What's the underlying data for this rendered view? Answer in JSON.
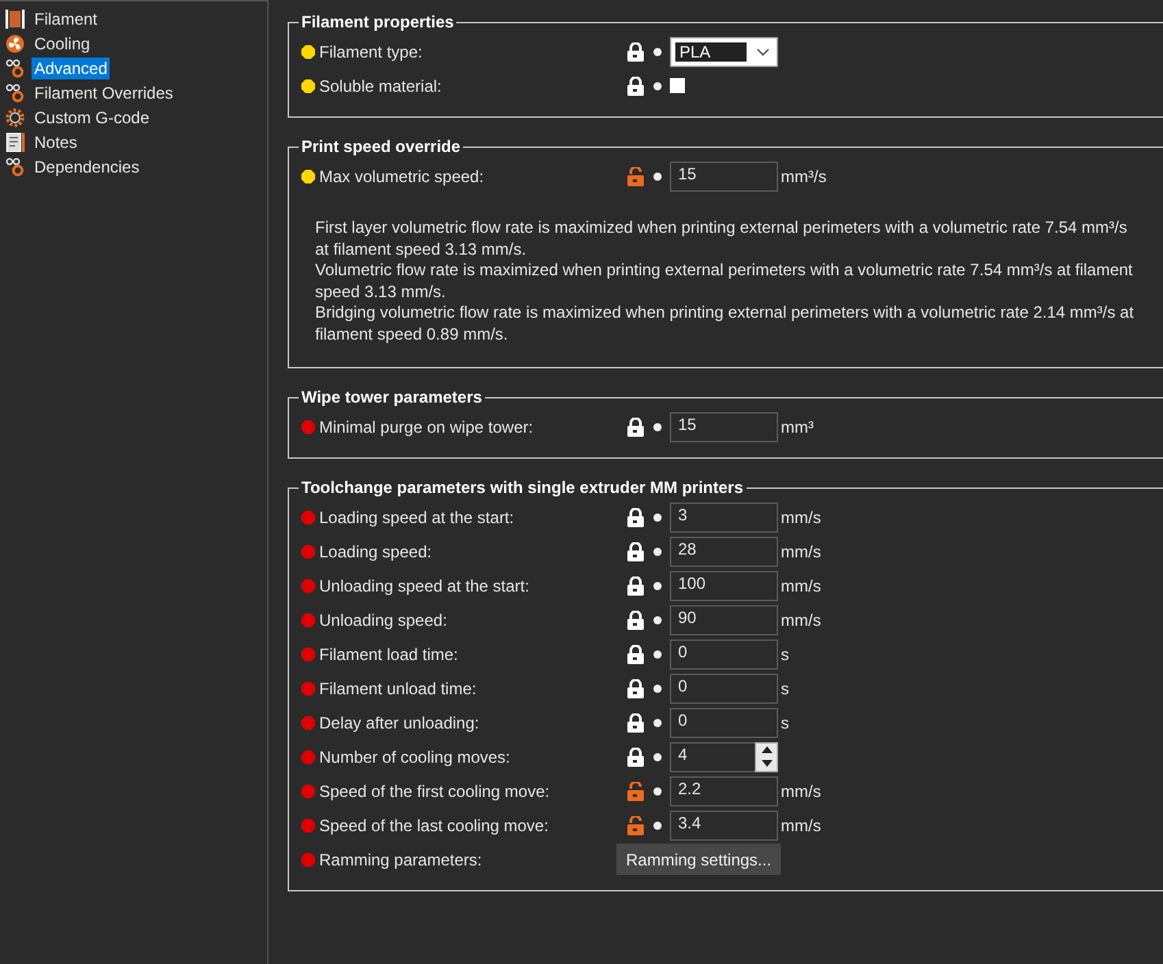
{
  "sidebar": {
    "items": [
      {
        "label": "Filament",
        "selected": false
      },
      {
        "label": "Cooling",
        "selected": false
      },
      {
        "label": "Advanced",
        "selected": true
      },
      {
        "label": "Filament Overrides",
        "selected": false
      },
      {
        "label": "Custom G-code",
        "selected": false
      },
      {
        "label": "Notes",
        "selected": false
      },
      {
        "label": "Dependencies",
        "selected": false
      }
    ]
  },
  "groups": [
    {
      "title": "Filament properties",
      "rows": [
        {
          "label": "Filament type:",
          "color": "#ffd700",
          "locked": true,
          "kind": "combo",
          "value": "PLA"
        },
        {
          "label": "Soluble material:",
          "color": "#ffd700",
          "locked": true,
          "kind": "checkbox",
          "checked": false
        }
      ]
    },
    {
      "title": "Print speed override",
      "rows": [
        {
          "label": "Max volumetric speed:",
          "color": "#ffd700",
          "locked": false,
          "kind": "text",
          "value": "15",
          "unit": "mm³/s"
        }
      ],
      "notes": [
        "First layer volumetric flow rate is maximized when printing external perimeters with a volumetric rate 7.54 mm³/s at filament speed 3.13 mm/s.",
        "Volumetric flow rate is maximized when printing external perimeters with a volumetric rate 7.54 mm³/s at filament speed 3.13 mm/s.",
        "Bridging volumetric flow rate is maximized when printing external perimeters with a volumetric rate 2.14 mm³/s at filament speed 0.89 mm/s."
      ]
    },
    {
      "title": "Wipe tower parameters",
      "rows": [
        {
          "label": "Minimal purge on wipe tower:",
          "color": "#e00000",
          "locked": true,
          "kind": "text",
          "value": "15",
          "unit": "mm³"
        }
      ]
    },
    {
      "title": "Toolchange parameters with single extruder MM printers",
      "rows": [
        {
          "label": "Loading speed at the start:",
          "color": "#e00000",
          "locked": true,
          "kind": "text",
          "value": "3",
          "unit": "mm/s"
        },
        {
          "label": "Loading speed:",
          "color": "#e00000",
          "locked": true,
          "kind": "text",
          "value": "28",
          "unit": "mm/s"
        },
        {
          "label": "Unloading speed at the start:",
          "color": "#e00000",
          "locked": true,
          "kind": "text",
          "value": "100",
          "unit": "mm/s"
        },
        {
          "label": "Unloading speed:",
          "color": "#e00000",
          "locked": true,
          "kind": "text",
          "value": "90",
          "unit": "mm/s"
        },
        {
          "label": "Filament load time:",
          "color": "#e00000",
          "locked": true,
          "kind": "text",
          "value": "0",
          "unit": "s"
        },
        {
          "label": "Filament unload time:",
          "color": "#e00000",
          "locked": true,
          "kind": "text",
          "value": "0",
          "unit": "s"
        },
        {
          "label": "Delay after unloading:",
          "color": "#e00000",
          "locked": true,
          "kind": "text",
          "value": "0",
          "unit": "s"
        },
        {
          "label": "Number of cooling moves:",
          "color": "#e00000",
          "locked": true,
          "kind": "spin",
          "value": "4"
        },
        {
          "label": "Speed of the first cooling move:",
          "color": "#e00000",
          "locked": false,
          "kind": "text",
          "value": "2.2",
          "unit": "mm/s"
        },
        {
          "label": "Speed of the last cooling move:",
          "color": "#e00000",
          "locked": false,
          "kind": "text",
          "value": "3.4",
          "unit": "mm/s"
        },
        {
          "label": "Ramming parameters:",
          "color": "#e00000",
          "kind": "button",
          "button": "Ramming settings..."
        }
      ]
    }
  ]
}
